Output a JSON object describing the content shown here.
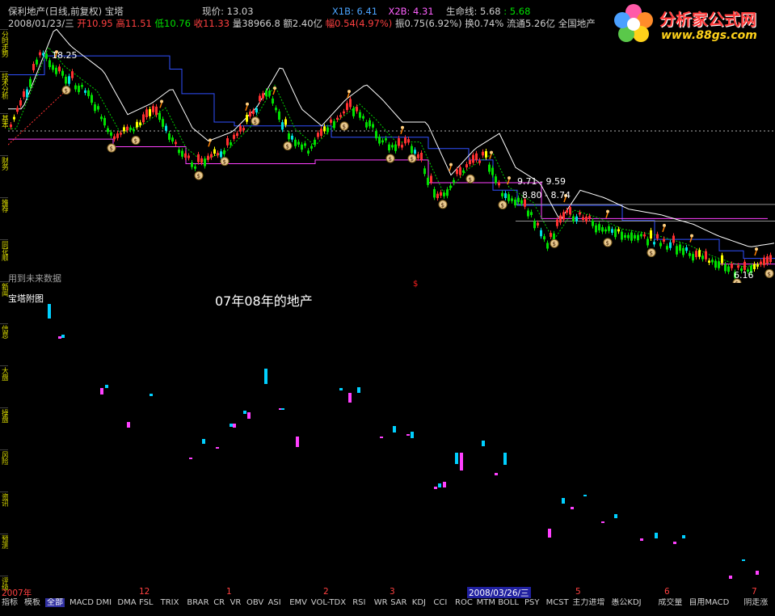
{
  "header": {
    "stock_name": "保利地产(日线,前复权)",
    "indicator_name": "宝塔",
    "price_label": "现价:",
    "price_value": "13.03",
    "x1b": "X1B: 6.41",
    "x2b": "X2B: 4.31",
    "lifeline_label": "生命线: 5.68",
    "lifeline_value": ": 5.68",
    "date": "2008/01/23/三",
    "open": "开10.95",
    "high": "高11.51",
    "low": "低10.76",
    "close": "收11.33",
    "volume": "量38966.8",
    "amount": "额2.40亿",
    "change": "幅0.54(4.97%)",
    "amplitude": "振0.75(6.92%)",
    "turnover": "换0.74%",
    "float": "流通5.26亿",
    "sector": "全国地产"
  },
  "logo": {
    "name": "分析家公式网",
    "url": "www.88gs.com"
  },
  "sidebar_tabs": [
    "分时走势",
    "技术分析",
    "基本",
    "财务",
    "推荐",
    "同花顺",
    "新闻",
    "信息",
    "大盘",
    "操盘",
    "风险",
    "资讯",
    "预测",
    "评级"
  ],
  "chart": {
    "labels": {
      "high_mark": "18.25",
      "level_a": "9.71 - 9.59",
      "level_b": "8.80 - 8.74",
      "low_mark": "6.16"
    },
    "no_future_data": "用到未来数据",
    "sub_title": "宝塔附图",
    "annotation": "07年08年的地产",
    "signal_mark": "$"
  },
  "colors": {
    "bg": "#000000",
    "up": "#ff3030",
    "down": "#00e000",
    "teal": "#00e0e0",
    "magenta": "#ff40ff",
    "blue": "#3050ff",
    "white": "#ffffff",
    "yellow": "#ffff00"
  },
  "x_axis": [
    "2007年",
    "12",
    "1",
    "2",
    "3",
    "2008/03/26/三",
    "5",
    "6",
    "7"
  ],
  "bottom_tabs": [
    "指标",
    "模板",
    "全部",
    "MACD",
    "DMI",
    "DMA",
    "FSL",
    "TRIX",
    "BRAR",
    "CR",
    "VR",
    "OBV",
    "ASI",
    "EMV",
    "VOL-TDX",
    "RSI",
    "WR",
    "SAR",
    "KDJ",
    "CCI",
    "ROC",
    "MTM",
    "BOLL",
    "PSY",
    "MCST",
    "主力进增",
    "愚公KDJ",
    "成交量",
    "自用MACD",
    "阴走涨"
  ],
  "active_tab": "全部"
}
